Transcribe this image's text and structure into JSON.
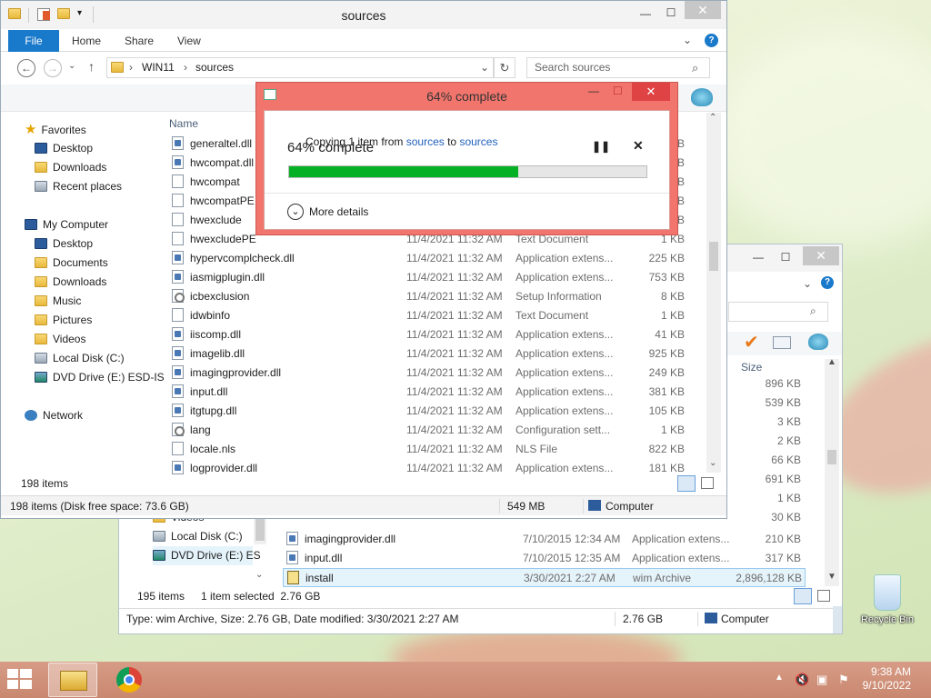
{
  "main_window": {
    "title": "sources",
    "ribbon_tabs": [
      "File",
      "Home",
      "Share",
      "View"
    ],
    "breadcrumb": [
      "WIN11",
      "sources"
    ],
    "search_placeholder": "Search sources",
    "column_name": "Name",
    "nav": {
      "favorites": "Favorites",
      "fav_items": [
        "Desktop",
        "Downloads",
        "Recent places"
      ],
      "computer": "My Computer",
      "computer_items": [
        "Desktop",
        "Documents",
        "Downloads",
        "Music",
        "Pictures",
        "Videos",
        "Local Disk (C:)",
        "DVD Drive (E:) ESD-IS"
      ],
      "network": "Network"
    },
    "files": [
      {
        "name": "generaltel.dll",
        "date": "",
        "type": "",
        "size": "KB",
        "icon": "dll"
      },
      {
        "name": "hwcompat.dll",
        "date": "",
        "type": "",
        "size": "KB",
        "icon": "dll"
      },
      {
        "name": "hwcompat",
        "date": "",
        "type": "",
        "size": "KB",
        "icon": "txt"
      },
      {
        "name": "hwcompatPE",
        "date": "",
        "type": "",
        "size": "KB",
        "icon": "txt"
      },
      {
        "name": "hwexclude",
        "date": "",
        "type": "",
        "size": "KB",
        "icon": "txt"
      },
      {
        "name": "hwexcludePE",
        "date": "11/4/2021 11:32 AM",
        "type": "Text Document",
        "size": "1 KB",
        "icon": "txt"
      },
      {
        "name": "hypervcomplcheck.dll",
        "date": "11/4/2021 11:32 AM",
        "type": "Application extens...",
        "size": "225 KB",
        "icon": "dll"
      },
      {
        "name": "iasmigplugin.dll",
        "date": "11/4/2021 11:32 AM",
        "type": "Application extens...",
        "size": "753 KB",
        "icon": "dll"
      },
      {
        "name": "icbexclusion",
        "date": "11/4/2021 11:32 AM",
        "type": "Setup Information",
        "size": "8 KB",
        "icon": "gear"
      },
      {
        "name": "idwbinfo",
        "date": "11/4/2021 11:32 AM",
        "type": "Text Document",
        "size": "1 KB",
        "icon": "txt"
      },
      {
        "name": "iiscomp.dll",
        "date": "11/4/2021 11:32 AM",
        "type": "Application extens...",
        "size": "41 KB",
        "icon": "dll"
      },
      {
        "name": "imagelib.dll",
        "date": "11/4/2021 11:32 AM",
        "type": "Application extens...",
        "size": "925 KB",
        "icon": "dll"
      },
      {
        "name": "imagingprovider.dll",
        "date": "11/4/2021 11:32 AM",
        "type": "Application extens...",
        "size": "249 KB",
        "icon": "dll"
      },
      {
        "name": "input.dll",
        "date": "11/4/2021 11:32 AM",
        "type": "Application extens...",
        "size": "381 KB",
        "icon": "dll"
      },
      {
        "name": "itgtupg.dll",
        "date": "11/4/2021 11:32 AM",
        "type": "Application extens...",
        "size": "105 KB",
        "icon": "dll"
      },
      {
        "name": "lang",
        "date": "11/4/2021 11:32 AM",
        "type": "Configuration sett...",
        "size": "1 KB",
        "icon": "gear"
      },
      {
        "name": "locale.nls",
        "date": "11/4/2021 11:32 AM",
        "type": "NLS File",
        "size": "822 KB",
        "icon": "txt"
      },
      {
        "name": "logprovider.dll",
        "date": "11/4/2021 11:32 AM",
        "type": "Application extens...",
        "size": "181 KB",
        "icon": "dll"
      }
    ],
    "item_count": "198 items",
    "status_left": "198 items (Disk free space: 73.6 GB)",
    "status_size": "549 MB",
    "status_location": "Computer"
  },
  "back_window": {
    "column_size": "Size",
    "sizes": [
      "896 KB",
      "539 KB",
      "3 KB",
      "2 KB",
      "66 KB",
      "691 KB",
      "1 KB",
      "30 KB"
    ],
    "nav_items": [
      "Videos",
      "Local Disk (C:)",
      "DVD Drive (E:) ES"
    ],
    "files": [
      {
        "name": "imagingprovider.dll",
        "date": "7/10/2015 12:34 AM",
        "type": "Application extens...",
        "size": "210 KB",
        "icon": "dll",
        "selected": false
      },
      {
        "name": "input.dll",
        "date": "7/10/2015 12:35 AM",
        "type": "Application extens...",
        "size": "317 KB",
        "icon": "dll",
        "selected": false
      },
      {
        "name": "install",
        "date": "3/30/2021 2:27 AM",
        "type": "wim Archive",
        "size": "2,896,128 KB",
        "icon": "wim",
        "selected": true
      }
    ],
    "item_count": "195 items",
    "selection": "1 item selected  2.76 GB",
    "status_left": "Type: wim Archive, Size: 2.76 GB, Date modified: 3/30/2021 2:27 AM",
    "status_size": "2.76 GB",
    "status_location": "Computer"
  },
  "copy_dialog": {
    "title": "64% complete",
    "line_prefix": "Copying 1 item from ",
    "source": "sources",
    "line_mid": " to ",
    "dest": "sources",
    "heading": "64% complete",
    "progress": 0.64,
    "more_details": "More details"
  },
  "desktop": {
    "recycle_bin": "Recycle Bin"
  },
  "taskbar": {
    "time": "9:38 AM",
    "date": "9/10/2022"
  }
}
